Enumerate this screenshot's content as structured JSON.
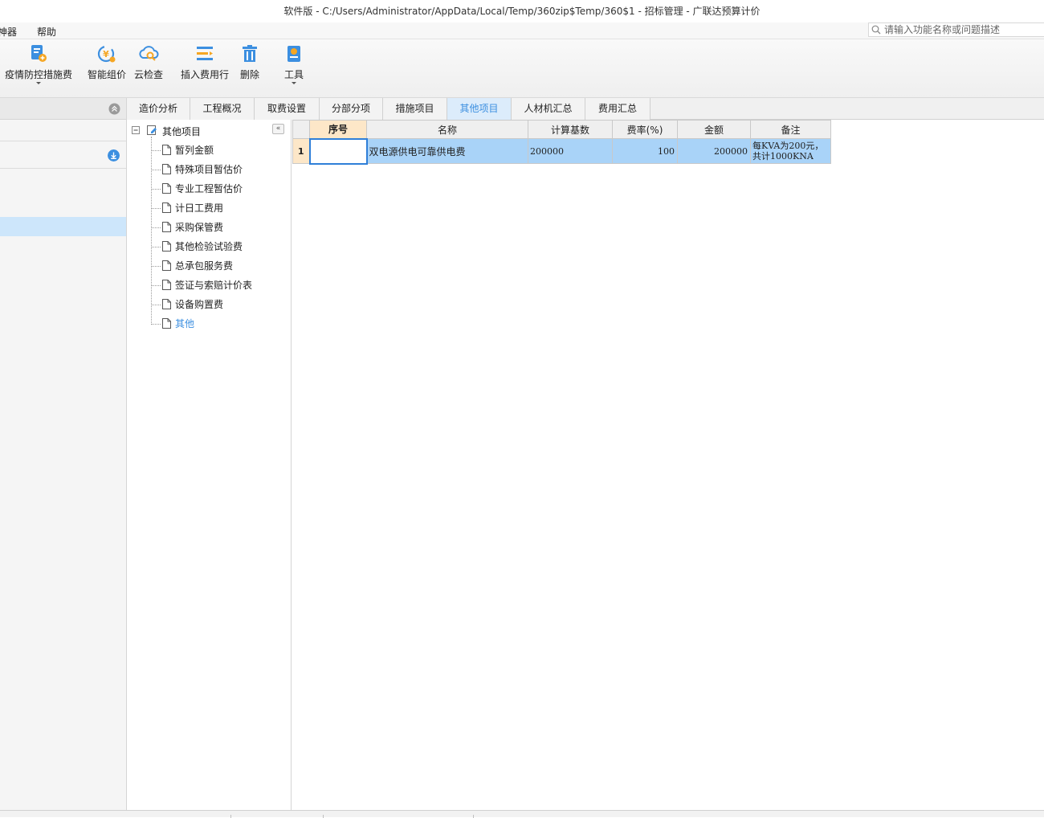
{
  "window": {
    "title": "软件版 - C:/Users/Administrator/AppData/Local/Temp/360zip$Temp/360$1 - 招标管理 - 广联达预算计价"
  },
  "menu": {
    "items": [
      "神器",
      "帮助"
    ]
  },
  "search": {
    "placeholder": "请输入功能名称或问题描述"
  },
  "toolbar": {
    "buttons": [
      {
        "label": "疫情防控措施费",
        "icon": "epidemic-fee-icon",
        "has_dropdown": true
      },
      {
        "label": "智能组价",
        "icon": "smart-pricing-icon",
        "has_dropdown": false
      },
      {
        "label": "云检查",
        "icon": "cloud-check-icon",
        "has_dropdown": false
      },
      {
        "label": "插入费用行",
        "icon": "insert-row-icon",
        "has_dropdown": false
      },
      {
        "label": "删除",
        "icon": "trash-icon",
        "has_dropdown": false
      },
      {
        "label": "工具",
        "icon": "tools-icon",
        "has_dropdown": true
      }
    ]
  },
  "tabs": [
    {
      "label": "造价分析",
      "active": false
    },
    {
      "label": "工程概况",
      "active": false
    },
    {
      "label": "取费设置",
      "active": false
    },
    {
      "label": "分部分项",
      "active": false
    },
    {
      "label": "措施项目",
      "active": false
    },
    {
      "label": "其他项目",
      "active": true
    },
    {
      "label": "人材机汇总",
      "active": false
    },
    {
      "label": "费用汇总",
      "active": false
    }
  ],
  "tree": {
    "root": "其他项目",
    "items": [
      {
        "label": "暂列金额",
        "active": false
      },
      {
        "label": "特殊项目暂估价",
        "active": false
      },
      {
        "label": "专业工程暂估价",
        "active": false
      },
      {
        "label": "计日工费用",
        "active": false
      },
      {
        "label": "采购保管费",
        "active": false
      },
      {
        "label": "其他检验试验费",
        "active": false
      },
      {
        "label": "总承包服务费",
        "active": false
      },
      {
        "label": "签证与索赔计价表",
        "active": false
      },
      {
        "label": "设备购置费",
        "active": false
      },
      {
        "label": "其他",
        "active": true
      }
    ]
  },
  "grid": {
    "columns": [
      "序号",
      "名称",
      "计算基数",
      "费率(%)",
      "金额",
      "备注"
    ],
    "rows": [
      {
        "row_number": "1",
        "seq": "",
        "name": "双电源供电可靠供电费",
        "base": "200000",
        "rate": "100",
        "amount": "200000",
        "note": "每KVA为200元，共计1000KNA"
      }
    ]
  },
  "colors": {
    "accent": "#3c8fe0",
    "selected_row": "#a9d3f8",
    "header_highlight": "#fde7c8"
  }
}
